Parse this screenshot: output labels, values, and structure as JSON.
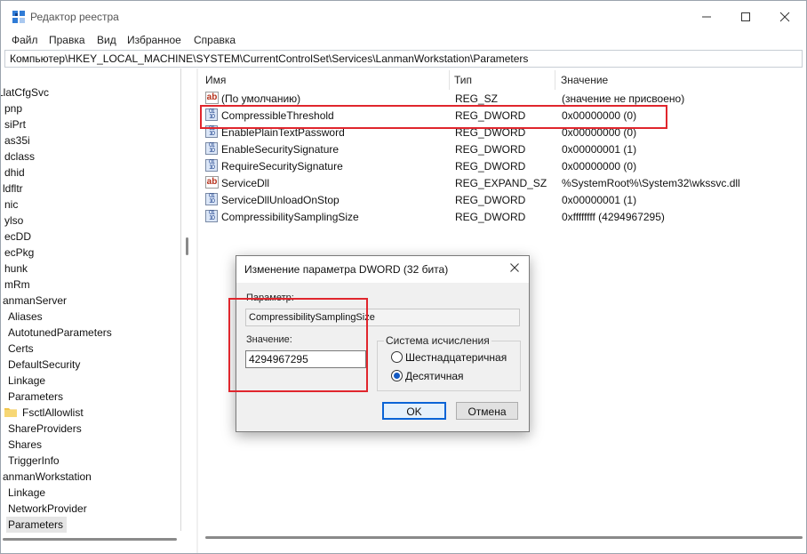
{
  "window": {
    "title": "Редактор реестра"
  },
  "menu": [
    "Файл",
    "Правка",
    "Вид",
    "Избранное",
    "Справка"
  ],
  "address": "Компьютер\\HKEY_LOCAL_MACHINE\\SYSTEM\\CurrentControlSet\\Services\\LanmanWorkstation\\Parameters",
  "tree": {
    "items": [
      "LlatCfgSvc",
      "pnp",
      "siPrt",
      "as35i",
      "dclass",
      "dhid",
      "ldfltr",
      "nic",
      "ylso",
      "ecDD",
      "ecPkg",
      "hunk",
      "mRm",
      "anmanServer",
      "Aliases",
      "AutotunedParameters",
      "Certs",
      "DefaultSecurity",
      "Linkage",
      "Parameters",
      "FsctlAllowlist",
      "ShareProviders",
      "Shares",
      "TriggerInfo",
      "anmanWorkstation",
      "Linkage",
      "NetworkProvider",
      "Parameters"
    ]
  },
  "list": {
    "columns": {
      "name": "Имя",
      "type": "Тип",
      "value": "Значение"
    },
    "rows": [
      {
        "icon": "string-value-icon",
        "name": "(По умолчанию)",
        "type": "REG_SZ",
        "value": "(значение не присвоено)"
      },
      {
        "icon": "binary-value-icon",
        "name": "CompressibleThreshold",
        "type": "REG_DWORD",
        "value": "0x00000000 (0)"
      },
      {
        "icon": "binary-value-icon",
        "name": "EnablePlainTextPassword",
        "type": "REG_DWORD",
        "value": "0x00000000 (0)"
      },
      {
        "icon": "binary-value-icon",
        "name": "EnableSecuritySignature",
        "type": "REG_DWORD",
        "value": "0x00000001 (1)"
      },
      {
        "icon": "binary-value-icon",
        "name": "RequireSecuritySignature",
        "type": "REG_DWORD",
        "value": "0x00000000 (0)"
      },
      {
        "icon": "string-value-icon",
        "name": "ServiceDll",
        "type": "REG_EXPAND_SZ",
        "value": "%SystemRoot%\\System32\\wkssvc.dll"
      },
      {
        "icon": "binary-value-icon",
        "name": "ServiceDllUnloadOnStop",
        "type": "REG_DWORD",
        "value": "0x00000001 (1)"
      },
      {
        "icon": "binary-value-icon",
        "name": "CompressibilitySamplingSize",
        "type": "REG_DWORD",
        "value": "0xffffffff (4294967295)"
      }
    ]
  },
  "dialog": {
    "title": "Изменение параметра DWORD (32 бита)",
    "param_label": "Параметр:",
    "param_value": "CompressibilitySamplingSize",
    "value_label": "Значение:",
    "value": "4294967295",
    "base_label": "Система исчисления",
    "radio_hex": "Шестнадцатеричная",
    "radio_dec": "Десятичная",
    "selected_base": "decimal",
    "ok": "OK",
    "cancel": "Отмена"
  },
  "colors": {
    "highlight_box": "#e0262d",
    "accent": "#0a64d6"
  }
}
